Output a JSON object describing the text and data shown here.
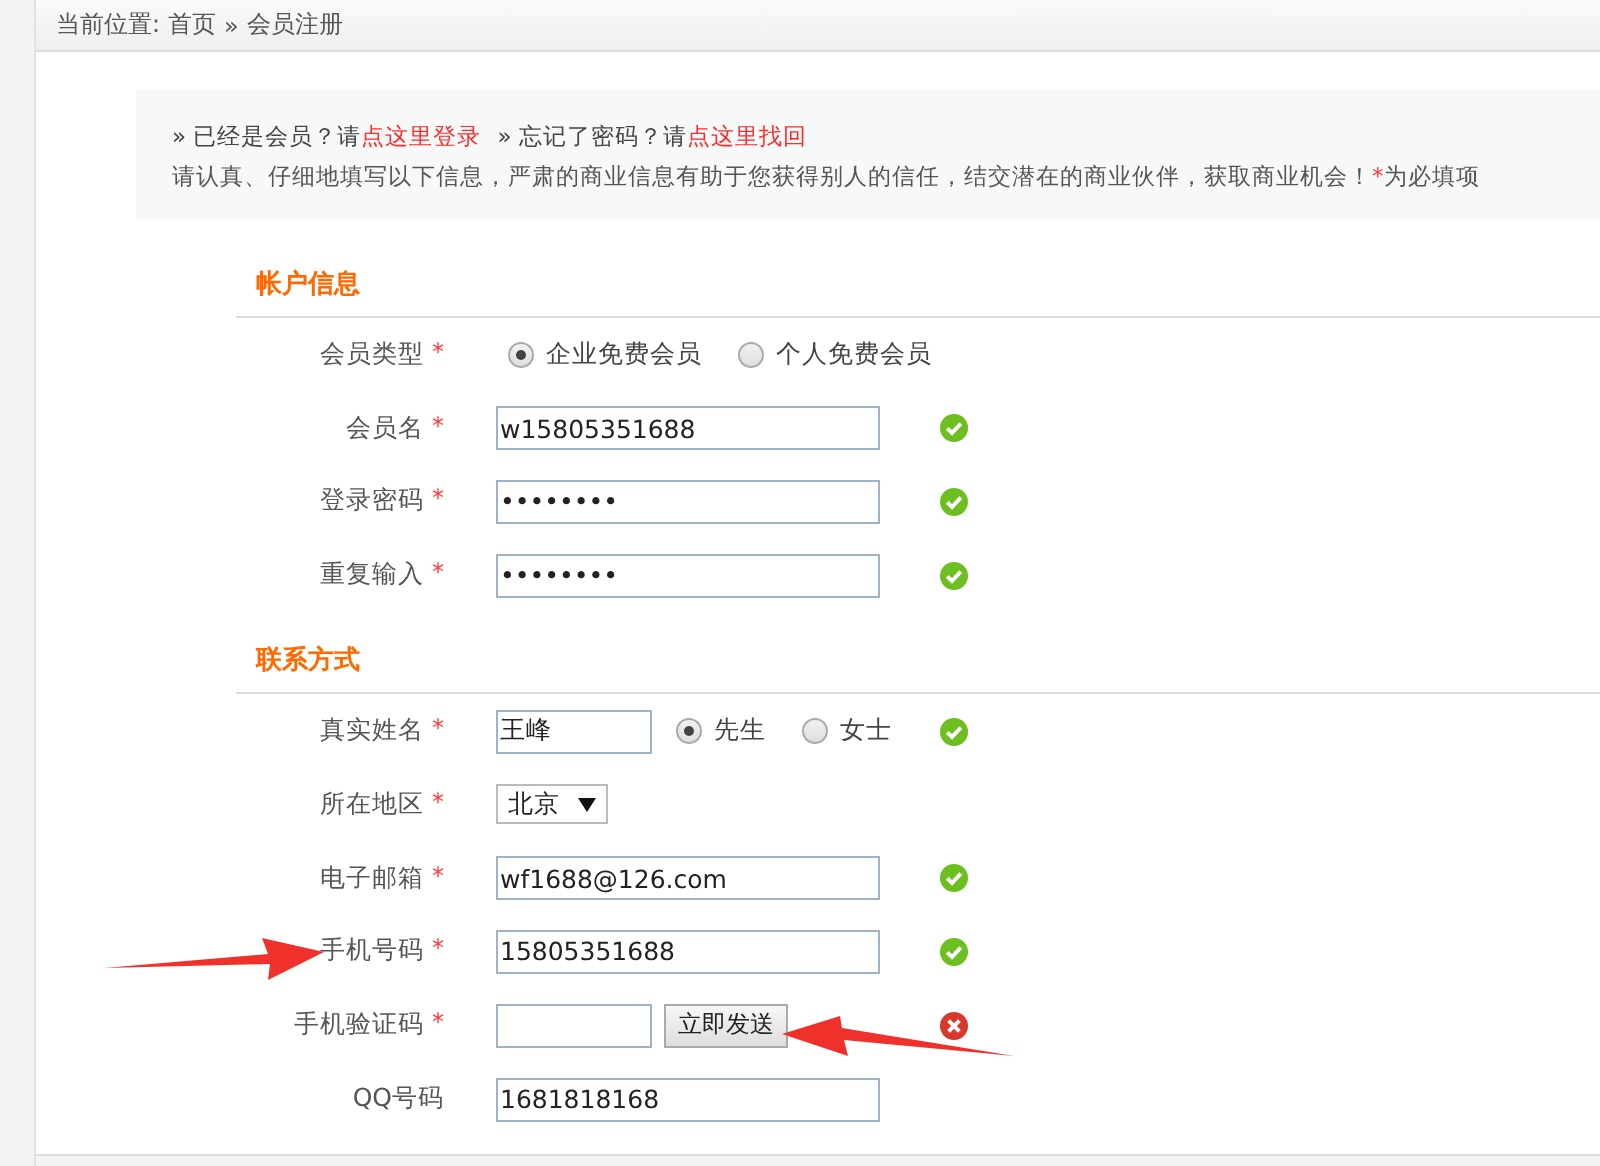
{
  "breadcrumb": {
    "prefix": "当前位置:",
    "links": [
      "首页",
      "会员注册"
    ],
    "separator": "»"
  },
  "notice": {
    "prompts": [
      {
        "text": "» 已经是会员？请",
        "link": "点这里登录"
      },
      {
        "text": "» 忘记了密码？请",
        "link": "点这里找回"
      }
    ],
    "info": "请认真、仔细地填写以下信息，严肃的商业信息有助于您获得别人的信任，结交潜在的商业伙伴，获取商业机会！",
    "required_mark": "*",
    "required_text": "为必填项"
  },
  "sections": [
    {
      "title": "帐户信息",
      "rows": [
        {
          "kind": "radio",
          "label": "会员类型",
          "mark": "*",
          "options": [
            {
              "label": "企业免费会员",
              "selected": true
            },
            {
              "label": "个人免费会员",
              "selected": false
            }
          ]
        },
        {
          "kind": "text",
          "label": "会员名",
          "mark": "*",
          "value": "w15805351688",
          "valid": true
        },
        {
          "kind": "text",
          "label": "登录密码",
          "mark": "*",
          "value": "••••••••",
          "valid": true
        },
        {
          "kind": "text",
          "label": "重复输入",
          "mark": "*",
          "value": "••••••••",
          "valid": true
        }
      ]
    },
    {
      "title": "联系方式",
      "rows": [
        {
          "kind": "name",
          "label": "真实姓名",
          "mark": "*",
          "value": "王峰",
          "options": [
            {
              "label": "先生",
              "selected": true
            },
            {
              "label": "女士",
              "selected": false
            }
          ],
          "valid": true
        },
        {
          "kind": "select",
          "label": "所在地区",
          "mark": "*",
          "value": "北京"
        },
        {
          "kind": "text",
          "label": "电子邮箱",
          "mark": "*",
          "value": "wf1688@126.com",
          "valid": true
        },
        {
          "kind": "text",
          "label": "手机号码",
          "mark": "*",
          "value": "15805351688",
          "valid": true
        },
        {
          "kind": "code",
          "label": "手机验证码",
          "mark": "*",
          "button": "立即发送",
          "valid": false
        },
        {
          "kind": "text",
          "label": "QQ号码",
          "value": "1681818168"
        }
      ]
    }
  ]
}
